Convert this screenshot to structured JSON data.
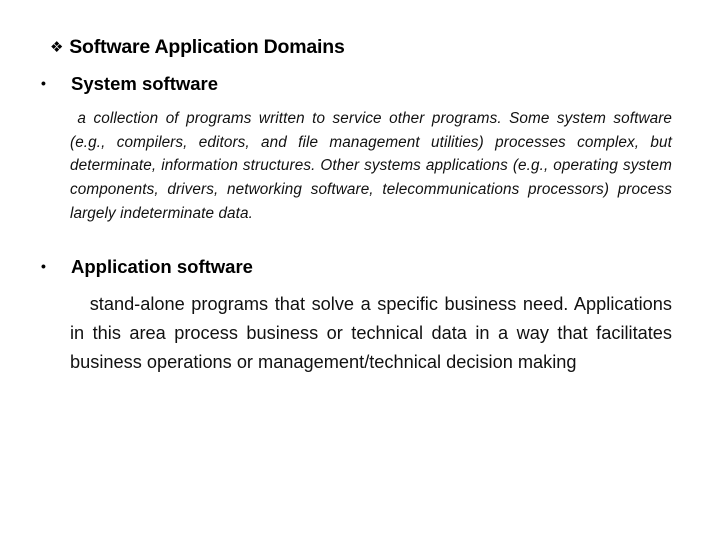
{
  "slide": {
    "title": "Software Application Domains",
    "title_icon": "diamond-bullet-icon",
    "sections": [
      {
        "heading": "System software",
        "bullet_icon": "bullet-dot-icon",
        "body": " a collection of programs written to service other programs. Some system software (e.g., compilers, editors, and file management utilities) processes complex, but determinate, information structures. Other systems applications (e.g., operating system components, drivers, networking software, telecommunications processors) process largely indeterminate data."
      },
      {
        "heading": "Application software",
        "bullet_icon": "bullet-dot-icon",
        "body": "   stand-alone programs that solve a specific business need. Applications in this area process business or technical data in a way that facilitates business operations or management/technical decision making"
      }
    ]
  }
}
